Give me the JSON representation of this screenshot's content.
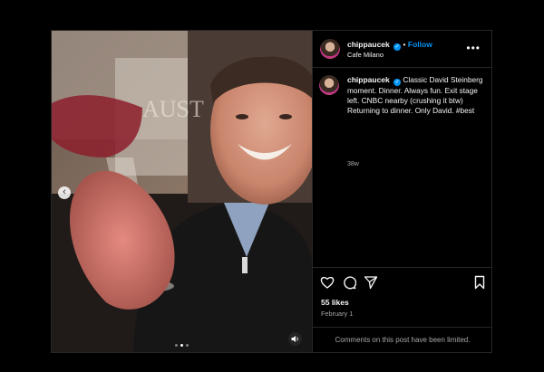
{
  "post": {
    "username": "chippaucek",
    "follow_label": "Follow",
    "location": "Cafe Milano",
    "caption": "Classic David Steinberg moment. Dinner. Always fun. Exit stage left. CNBC nearby (crushing it btw) Returning to dinner. Only David. #best",
    "age": "38w",
    "likes": "55 likes",
    "date": "February 1",
    "comments_notice": "Comments on this post have been limited.",
    "background_text": "AUST",
    "carousel": {
      "count": 3,
      "active_index": 1
    }
  },
  "icons": {
    "verified": "verified-badge-icon",
    "more": "more-options-icon",
    "like": "heart-icon",
    "comment": "comment-icon",
    "share": "send-icon",
    "save": "bookmark-icon",
    "prev": "chevron-left-icon",
    "audio": "audio-muted-icon"
  },
  "colors": {
    "accent": "#0095f6",
    "background": "#000000",
    "secondary_text": "#a8a8a8",
    "border": "#262626"
  }
}
